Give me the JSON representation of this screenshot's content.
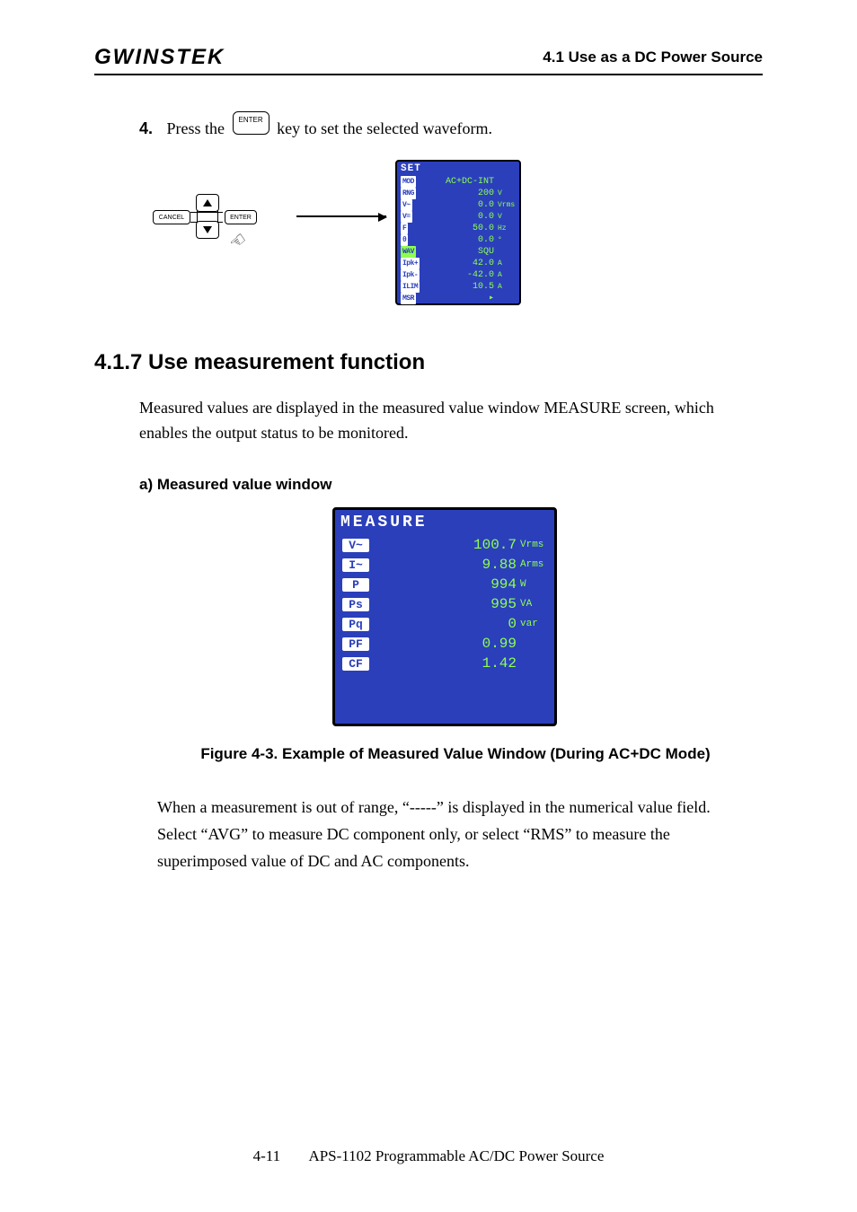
{
  "header": {
    "logo": "GWINSTEK",
    "section": "4.1 Use as a DC Power Source"
  },
  "step4": {
    "num": "4.",
    "pre": "Press the",
    "key": "ENTER",
    "post": " key to set the selected waveform."
  },
  "controls": {
    "cancel": "CANCEL",
    "enter": "ENTER"
  },
  "set_screen": {
    "title": "SET",
    "mode": "AC+DC-INT",
    "rows": [
      {
        "label": "MOD",
        "value": "AC+DC-INT",
        "unit": ""
      },
      {
        "label": "RNG",
        "value": "200",
        "unit": "V"
      },
      {
        "label": "V~",
        "value": "0.0",
        "unit": "Vrms"
      },
      {
        "label": "V=",
        "value": "0.0",
        "unit": "V"
      },
      {
        "label": "F",
        "value": "50.0",
        "unit": "Hz"
      },
      {
        "label": "θ",
        "value": "0.0",
        "unit": "°"
      },
      {
        "label": "WAV",
        "value": "SQU",
        "unit": ""
      },
      {
        "label": "Ipk+",
        "value": "42.0",
        "unit": "A"
      },
      {
        "label": "Ipk-",
        "value": "-42.0",
        "unit": "A"
      },
      {
        "label": "ILIM",
        "value": "10.5",
        "unit": "A"
      },
      {
        "label": "MSR",
        "value": "▸",
        "unit": ""
      }
    ]
  },
  "heading_417": "4.1.7  Use measurement function",
  "para1": "Measured values are displayed in the measured value window MEASURE screen, which enables the output status to be monitored.",
  "sub_a": "a) Measured value window",
  "measure_screen": {
    "title": "MEASURE",
    "rows": [
      {
        "label": "V~",
        "value": "100.7",
        "unit": "Vrms"
      },
      {
        "label": "I~",
        "value": "9.88",
        "unit": "Arms"
      },
      {
        "label": "P",
        "value": "994",
        "unit": "W"
      },
      {
        "label": "Ps",
        "value": "995",
        "unit": "VA"
      },
      {
        "label": "Pq",
        "value": "0",
        "unit": "var"
      },
      {
        "label": "PF",
        "value": "0.99",
        "unit": ""
      },
      {
        "label": "CF",
        "value": "1.42",
        "unit": ""
      }
    ]
  },
  "figure_caption": "Figure 4-3.  Example of Measured Value Window (During AC+DC Mode)",
  "para2_lines": [
    "When a measurement is out of range, “-----” is displayed in the numerical value field.",
    "Select “AVG” to measure DC component only, or select  “RMS” to measure the superimposed value of DC and AC components."
  ],
  "footer": {
    "page": "4-11",
    "doc": "APS-1102 Programmable AC/DC Power Source"
  }
}
